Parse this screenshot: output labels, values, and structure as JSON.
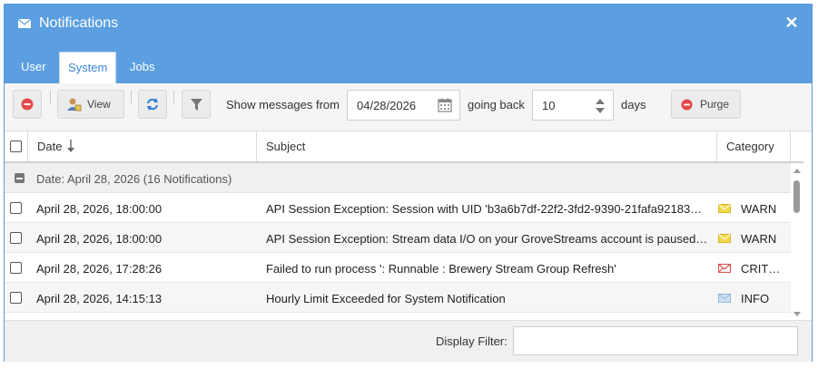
{
  "window": {
    "title": "Notifications",
    "icon": "envelope-icon",
    "close_icon": "close-icon"
  },
  "tabs": [
    {
      "label": "User",
      "active": false
    },
    {
      "label": "System",
      "active": true
    },
    {
      "label": "Jobs",
      "active": false
    }
  ],
  "toolbar": {
    "delete_icon": "delete-icon",
    "view_label": "View",
    "refresh_icon": "refresh-icon",
    "filter_icon": "filter-icon",
    "show_from_label": "Show messages from",
    "date_value": "04/28/2026",
    "going_back_label": "going back",
    "days_value": "10",
    "days_label": "days",
    "purge_label": "Purge"
  },
  "grid": {
    "columns": {
      "date": "Date",
      "subject": "Subject",
      "category": "Category"
    },
    "group_label": "Date: April 28, 2026 (16 Notifications)",
    "rows": [
      {
        "date": "April 28, 2026, 18:00:00",
        "subject": "API Session Exception: Session with UID 'b3a6b7df-22f2-3fd2-9390-21fafa92183…",
        "category": "WARN",
        "level": "warn"
      },
      {
        "date": "April 28, 2026, 18:00:00",
        "subject": "API Session Exception: Stream data I/O on your GroveStreams account is paused…",
        "category": "WARN",
        "level": "warn"
      },
      {
        "date": "April 28, 2026, 17:28:26",
        "subject": "Failed to run process ': Runnable : Brewery Stream Group Refresh'",
        "category": "CRIT…",
        "level": "crit"
      },
      {
        "date": "April 28, 2026, 14:15:13",
        "subject": "Hourly Limit Exceeded for System Notification",
        "category": "INFO",
        "level": "info"
      }
    ]
  },
  "footer": {
    "display_filter_label": "Display Filter:",
    "display_filter_value": ""
  },
  "colors": {
    "title_bar": "#5b9fe0",
    "warn": "#f1d94a",
    "crit": "#d9534f",
    "info": "#8fb8e0"
  }
}
